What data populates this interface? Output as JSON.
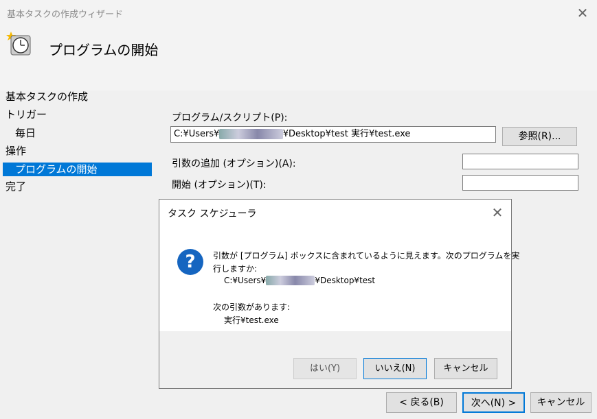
{
  "wizard": {
    "title": "基本タスクの作成ウィザード",
    "header_title": "プログラムの開始",
    "nav": {
      "create_task": "基本タスクの作成",
      "trigger": "トリガー",
      "daily": "毎日",
      "action": "操作",
      "start_program": "プログラムの開始",
      "finish": "完了"
    },
    "form": {
      "program_label": "プログラム/スクリプト(P):",
      "program_value_prefix": "C:¥Users¥",
      "program_value_suffix": "¥Desktop¥test 実行¥test.exe",
      "browse_button": "参照(R)...",
      "args_label": "引数の追加 (オプション)(A):",
      "args_value": "",
      "start_label": "開始 (オプション)(T):",
      "start_value": ""
    },
    "buttons": {
      "back": "< 戻る(B)",
      "next": "次へ(N) >",
      "cancel": "キャンセル"
    }
  },
  "dialog": {
    "title": "タスク スケジューラ",
    "message_line1": "引数が [プログラム] ボックスに含まれているように見えます。次のプログラムを実",
    "message_line2": "行しますか:",
    "path_prefix": "C:¥Users¥",
    "path_suffix": "¥Desktop¥test",
    "args_heading": "次の引数があります:",
    "args_value": "実行¥test.exe",
    "icon": "question-icon",
    "buttons": {
      "yes": "はい(Y)",
      "no": "いいえ(N)",
      "cancel": "キャンセル"
    }
  }
}
